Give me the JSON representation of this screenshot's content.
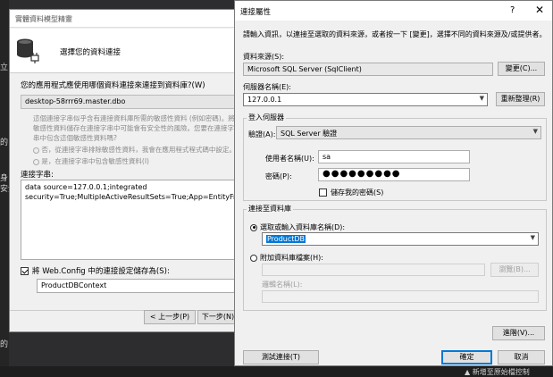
{
  "background": {
    "side_texts": [
      "立",
      "的",
      "身",
      "安全",
      "的"
    ],
    "status_text": "▲ 新增至原始檔控制"
  },
  "wizard": {
    "title": "實體資料模型精靈",
    "heading": "選擇您的資料連接",
    "question": "您的應用程式應使用哪個資料連接來連接到資料庫?(W)",
    "connection": "desktop-58rrr69.master.dbo",
    "sensitive_text": "這個連接字串似乎含有連接資料庫所需的敏感性資料 (例如密碼)。將敏感性資料儲存在連接字串中可能會有安全性的風險。您要在連接字串中包含這個敏感性資料嗎?",
    "sensitive_no": "否，從連接字串排除敏感性資料，我會在應用程式程式碼中設定。",
    "sensitive_yes": "是，在連接字串中包含敏感性資料(I)",
    "conn_string_label": "連接字串:",
    "conn_string_lines": [
      "data source=127.0.0.1;integrated",
      "security=True;MultipleActiveResultSets=True;App=EntityFramework"
    ],
    "save_label": "將 Web.Config 中的連接設定儲存為(S):",
    "save_checked": true,
    "context_name": "ProductDBContext",
    "prev_button": "< 上一步(P)",
    "next_button": "下一步(N)"
  },
  "dialog": {
    "title": "連接屬性",
    "help": "?",
    "close": "✕",
    "intro": "請輸入資訊，以連接至選取的資料來源，或者按一下 [變更]，選擇不同的資料來源及/或提供者。",
    "datasource_label": "資料來源(S):",
    "datasource_value": "Microsoft SQL Server (SqlClient)",
    "change_button": "變更(C)...",
    "server_label": "伺服器名稱(E):",
    "server_value": "127.0.0.1",
    "refresh_button": "重新整理(R)",
    "login_group": "登入伺服器",
    "auth_label": "驗證(A):",
    "auth_value": "SQL Server 驗證",
    "username_label": "使用者名稱(U):",
    "username_value": "sa",
    "password_label": "密碼(P):",
    "password_dots": "●●●●●●●●●",
    "save_password_label": "儲存我的密碼(S)",
    "save_password_checked": false,
    "db_group": "連接至資料庫",
    "select_db_label": "選取或輸入資料庫名稱(D):",
    "db_value": "ProductDB",
    "attach_label": "附加資料庫檔案(H):",
    "browse_button": "瀏覽(B)...",
    "logical_name_label": "邏輯名稱(L):",
    "advanced_button": "進階(V)...",
    "test_button": "測試連接(T)",
    "ok_button": "確定",
    "cancel_button": "取消"
  }
}
